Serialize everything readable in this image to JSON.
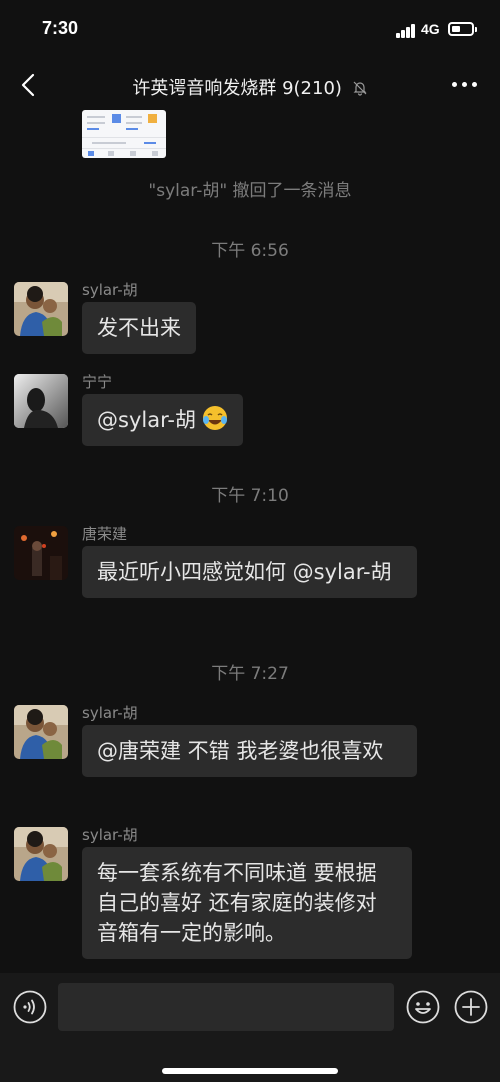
{
  "status_bar": {
    "time": "7:30",
    "network": "4G",
    "battery_level": 0.3
  },
  "nav": {
    "title": "许英谔音响发烧群 9(210)",
    "back_icon": "chevron-left-icon",
    "mute_icon": "bell-off-icon",
    "more_icon": "ellipsis-icon"
  },
  "system": {
    "recall": "\"sylar-胡\" 撤回了一条消息",
    "time1": "下午 6:56",
    "time2": "下午 7:10",
    "time3": "下午 7:27"
  },
  "messages": [
    {
      "sender": "sylar-胡",
      "text": "发不出来"
    },
    {
      "sender": "宁宁",
      "text": "@sylar-胡",
      "emoji": "crying-laughing-emoji"
    },
    {
      "sender": "唐荣建",
      "text": "最近听小四感觉如何 @sylar-胡"
    },
    {
      "sender": "sylar-胡",
      "text": "@唐荣建 不错 我老婆也很喜欢"
    },
    {
      "sender": "sylar-胡",
      "text": "每一套系统有不同味道 要根据自己的喜好 还有家庭的装修对音箱有一定的影响。"
    }
  ],
  "input": {
    "value": "",
    "placeholder": ""
  },
  "icons": {
    "voice": "voice-icon",
    "emoji": "smiley-icon",
    "plus": "plus-icon"
  },
  "colors": {
    "background": "#111111",
    "bubble": "#2c2c2c",
    "accent": "#5b8be6"
  }
}
